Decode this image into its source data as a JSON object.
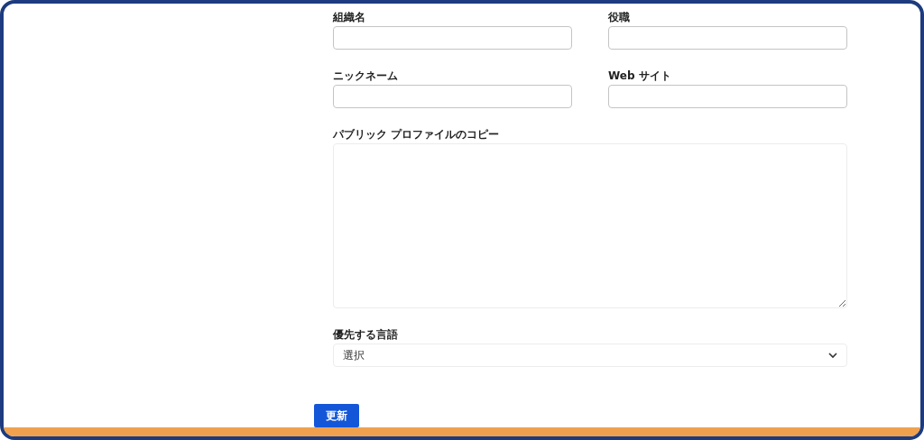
{
  "fields": [
    {
      "kind": "input",
      "label": "組織名"
    },
    {
      "kind": "input",
      "label": "役職"
    },
    {
      "kind": "input",
      "label": "ニックネーム"
    },
    {
      "kind": "input",
      "label": "Web サイト"
    },
    {
      "kind": "textarea",
      "label": "パブリック プロファイルのコピー"
    },
    {
      "kind": "select",
      "label": "優先する言語",
      "value": "選択"
    }
  ],
  "button": "更新"
}
